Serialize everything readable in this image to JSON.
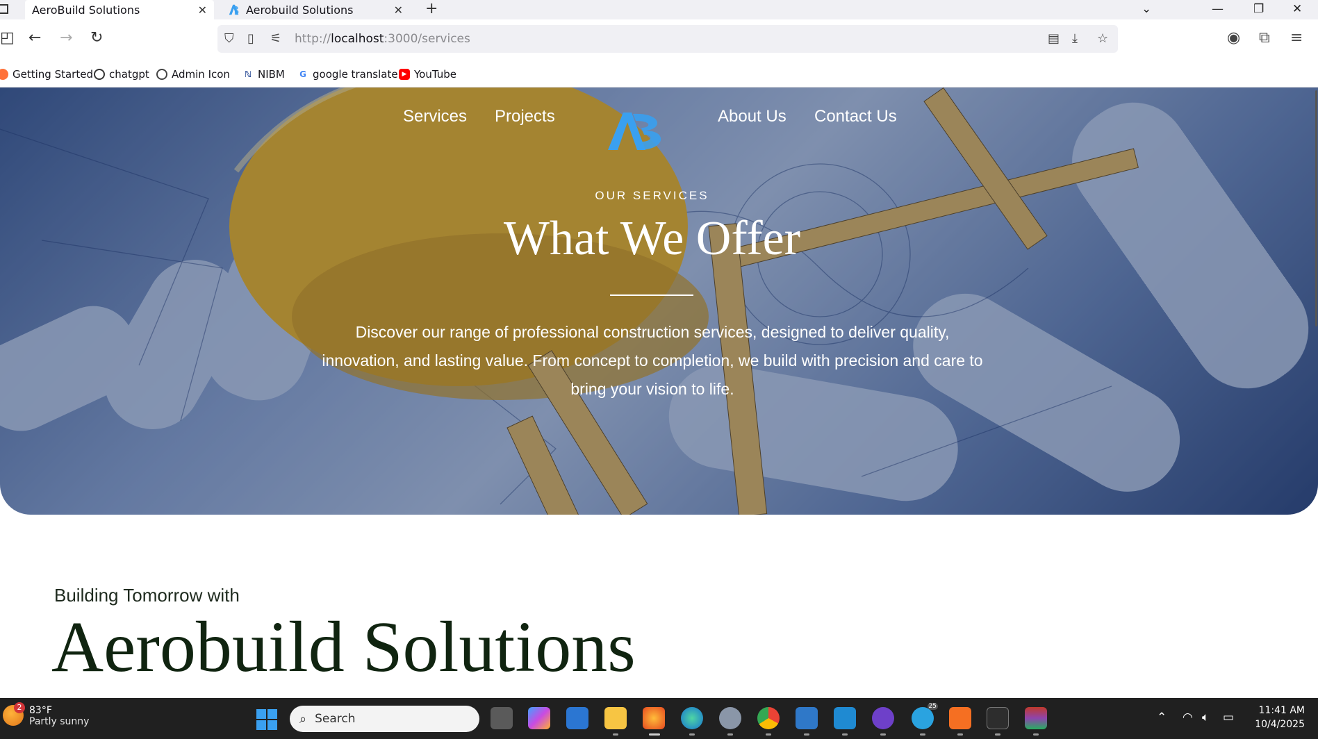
{
  "browser": {
    "tabs": [
      {
        "title": "AeroBuild Solutions",
        "active": true
      },
      {
        "title": "Aerobuild Solutions",
        "active": false
      }
    ],
    "url": {
      "prefix": "http://",
      "host": "localhost",
      "path": ":3000/services"
    },
    "bookmarks": [
      {
        "label": "Getting Started",
        "icon": "firefox-icon"
      },
      {
        "label": "chatgpt",
        "icon": "openai-icon"
      },
      {
        "label": "Admin Icon",
        "icon": "globe-icon"
      },
      {
        "label": "NIBM",
        "icon": "nibm-icon"
      },
      {
        "label": "google translate",
        "icon": "google-icon"
      },
      {
        "label": "YouTube",
        "icon": "youtube-icon"
      }
    ]
  },
  "site": {
    "nav": {
      "services": "Services",
      "projects": "Projects",
      "about": "About Us",
      "contact": "Contact Us"
    },
    "logo_text": "AB",
    "hero": {
      "eyebrow": "OUR SERVICES",
      "title": "What We Offer",
      "text": "Discover our range of professional construction services, designed to deliver quality, innovation, and lasting value. From concept to completion, we build with precision and care to bring your vision to life."
    },
    "section": {
      "subheading": "Building Tomorrow with",
      "heading": "Aerobuild Solutions"
    }
  },
  "taskbar": {
    "weather": {
      "temp": "83°F",
      "condition": "Partly sunny",
      "badge": "2"
    },
    "search_placeholder": "Search",
    "clock": {
      "time": "11:41 AM",
      "date": "10/4/2025"
    },
    "telegram_badge": "25"
  },
  "colors": {
    "accent": "#3aa0f0",
    "hero_overlay": "#2f4674",
    "heading": "#102410",
    "helmet": "#f2b51c"
  }
}
